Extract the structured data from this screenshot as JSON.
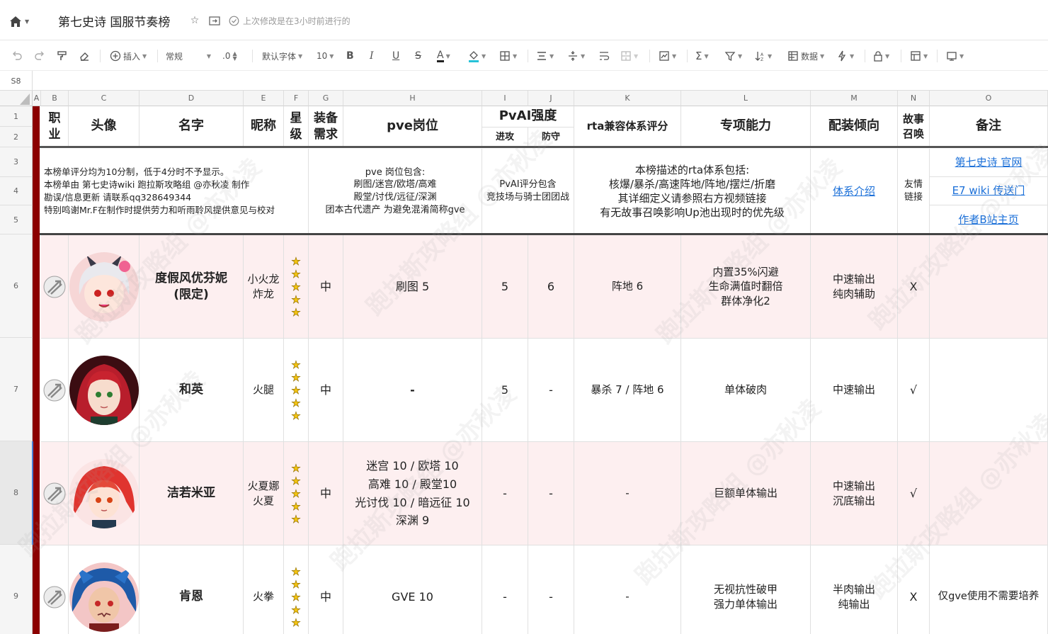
{
  "title_bar": {
    "doc_title": "第七史诗 国服节奏榜",
    "last_modified": "上次修改是在3小时前进行的"
  },
  "toolbar": {
    "insert_label": "插入",
    "format_select": "常规",
    "decimal_value": ".0",
    "font_select": "默认字体",
    "font_size": "10",
    "data_label": "数据"
  },
  "formula_bar": {
    "cell_ref": "S8"
  },
  "columns": [
    "A",
    "B",
    "C",
    "D",
    "E",
    "F",
    "G",
    "H",
    "I",
    "J",
    "K",
    "L",
    "M",
    "N",
    "O"
  ],
  "rows": [
    "1",
    "2",
    "3",
    "4",
    "5",
    "6",
    "7",
    "8",
    "9"
  ],
  "header": {
    "class": "职业",
    "avatar": "头像",
    "name": "名字",
    "nickname": "昵称",
    "star": "星级",
    "gear": "装备需求",
    "pve": "pve岗位",
    "pvai": "PvAI强度",
    "attack": "进攻",
    "defense": "防守",
    "rta": "rta兼容体系评分",
    "special": "专项能力",
    "build": "配装倾向",
    "story": "故事召唤",
    "notes": "备注"
  },
  "info": {
    "rating_note": [
      "本榜单评分均为10分制，低于4分时不予显示。",
      "本榜单由 第七史诗wiki 跑拉斯攻略组 @亦秋凌 制作",
      "勘误/信息更新 请联系qq328649344",
      "特别鸣谢Mr.F在制作时提供劳力和听雨聆风提供意见与校对"
    ],
    "pve_note": [
      "pve 岗位包含:",
      "刷图/迷宫/欧塔/高难",
      "殿堂/讨伐/远征/深渊",
      "团本古代遗产 为避免混淆简称gve"
    ],
    "pvai_note": [
      "PvAI评分包含",
      "竞技场与骑士团团战"
    ],
    "rta_note": [
      "本榜描述的rta体系包括:",
      "核爆/暴杀/高速阵地/阵地/摆烂/折磨",
      "其详细定义请参照右方视频链接",
      "有无故事召唤影响Up池出现时的优先级"
    ],
    "system_link": "体系介绍",
    "friend_link": "友情链接",
    "links": [
      "第七史诗 官网",
      "E7 wiki 传送门",
      "作者B站主页"
    ]
  },
  "characters": [
    {
      "name": "度假风优芬妮(限定)",
      "nickname": "小火龙 炸龙",
      "stars": 5,
      "gear": "中",
      "pve": [
        "刷图 5"
      ],
      "attack": "5",
      "defense": "6",
      "rta": "阵地 6",
      "special": [
        "内置35%闪避",
        "生命满值时翻倍",
        "群体净化2"
      ],
      "build": [
        "中速输出",
        "纯肉辅助"
      ],
      "story": "X",
      "notes": ""
    },
    {
      "name": "和英",
      "nickname": "火腿",
      "stars": 5,
      "gear": "中",
      "pve": [
        "-"
      ],
      "attack": "5",
      "defense": "-",
      "rta": "暴杀 7 / 阵地 6",
      "special": [
        "单体破肉"
      ],
      "build": [
        "中速输出"
      ],
      "story": "√",
      "notes": ""
    },
    {
      "name": "洁若米亚",
      "nickname": "火夏娜 火夏",
      "stars": 5,
      "gear": "中",
      "pve": [
        "迷宫 10 / 欧塔 10",
        "高难 10 / 殿堂10",
        "光讨伐 10 / 暗远征 10",
        "深渊 9"
      ],
      "attack": "-",
      "defense": "-",
      "rta": "-",
      "special": [
        "巨额单体输出"
      ],
      "build": [
        "中速输出",
        "沉底输出"
      ],
      "story": "√",
      "notes": ""
    },
    {
      "name": "肯恩",
      "nickname": "火拳",
      "stars": 5,
      "gear": "中",
      "pve": [
        "GVE 10"
      ],
      "attack": "-",
      "defense": "-",
      "rta": "-",
      "special": [
        "无视抗性破甲",
        "强力单体输出"
      ],
      "build": [
        "半肉输出",
        "纯输出"
      ],
      "story": "X",
      "notes": "仅gve使用不需要培养"
    }
  ],
  "watermark": "跑拉斯攻略组 @亦秋凌",
  "colors": {
    "accent_bar": "#8b0000",
    "pink_row": "#fdeff0",
    "link": "#1a6fd8",
    "star": "#f3c310"
  }
}
